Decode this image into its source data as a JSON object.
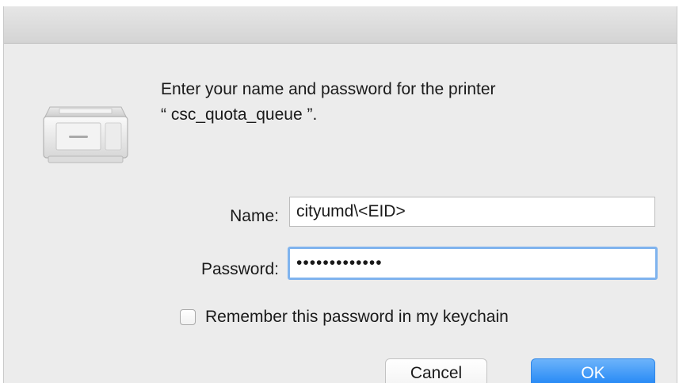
{
  "dialog": {
    "message_line1": "Enter your name and password for the printer",
    "message_line2": "“ csc_quota_queue ”."
  },
  "form": {
    "name_label": "Name:",
    "name_value": "cityumd\\<EID>",
    "password_label": "Password:",
    "password_value": "•••••••••••••",
    "remember_label": "Remember this password in my keychain",
    "remember_checked": false
  },
  "buttons": {
    "cancel_label": "Cancel",
    "ok_label": "OK"
  },
  "icons": {
    "printer": "printer-icon"
  },
  "colors": {
    "accent": "#1c83f5",
    "focus_ring": "#7fb3ee",
    "dialog_bg": "#ececec"
  }
}
